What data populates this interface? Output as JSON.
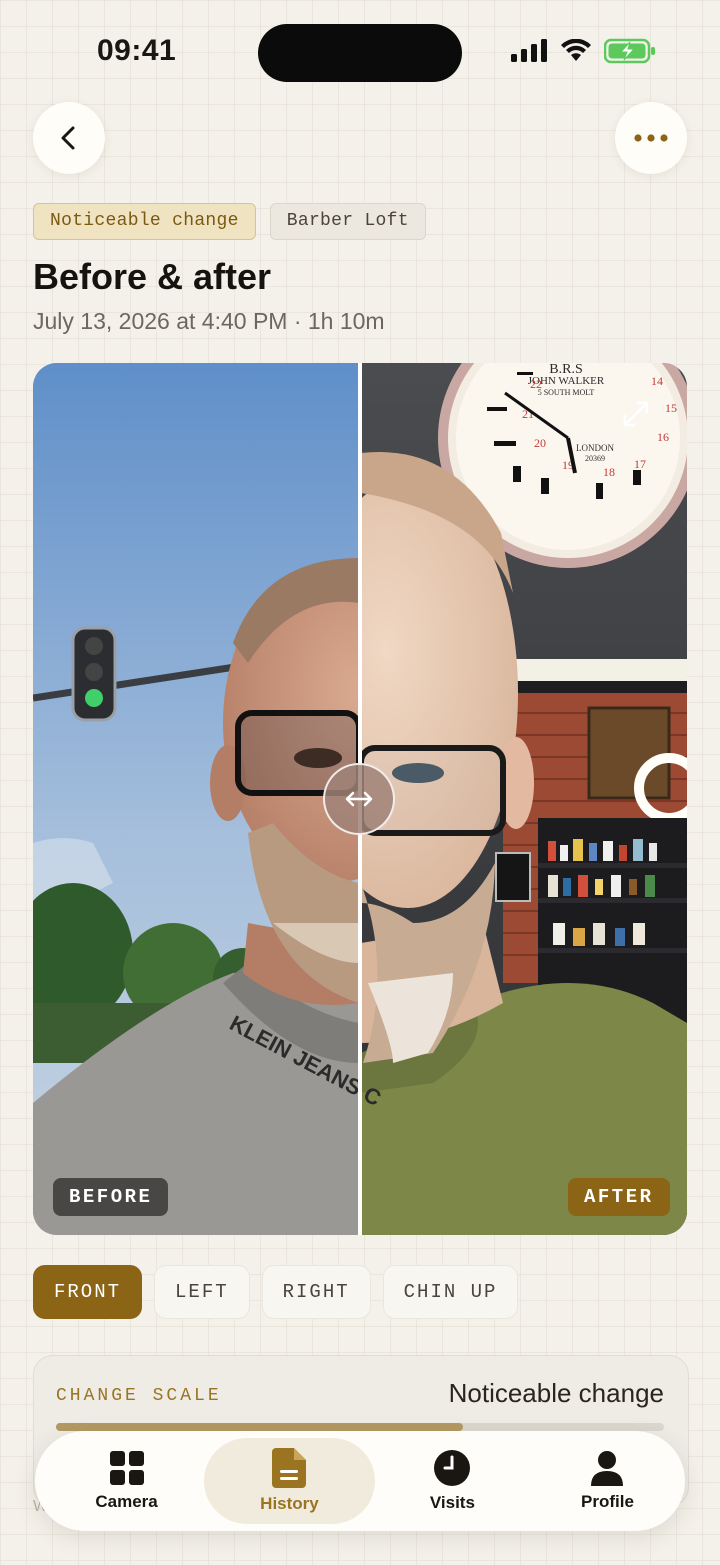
{
  "status_bar": {
    "time": "09:41"
  },
  "header": {
    "back_icon": "chevron-left-icon",
    "more_icon": "ellipsis-icon"
  },
  "tags": {
    "change": "Noticeable change",
    "shop": "Barber Loft"
  },
  "title": "Before & after",
  "subtitle": "July 13, 2026 at 4:40 PM · 1h 10m",
  "comparison": {
    "before_label": "BEFORE",
    "after_label": "AFTER",
    "slider_position": 0.5,
    "clock": {
      "brand": "B.R.S",
      "name": "JOHN WALKER",
      "street": "5 SOUTH MOLT",
      "city": "LONDON",
      "code": "20369"
    },
    "shirt_text": "KLEIN JEANS C"
  },
  "angles": [
    "FRONT",
    "LEFT",
    "RIGHT",
    "CHIN UP"
  ],
  "active_angle": 0,
  "change_scale": {
    "label": "CHANGE SCALE",
    "value": "Noticeable change",
    "level": 0.67
  },
  "footer_hint": "W",
  "nav": [
    {
      "label": "Camera",
      "icon": "grid-icon"
    },
    {
      "label": "History",
      "icon": "document-icon"
    },
    {
      "label": "Visits",
      "icon": "clock-icon"
    },
    {
      "label": "Profile",
      "icon": "person-icon"
    }
  ],
  "colors": {
    "accent": "#8b6416",
    "background": "#f4f1ea",
    "chip_change_bg": "#efe3c2"
  }
}
